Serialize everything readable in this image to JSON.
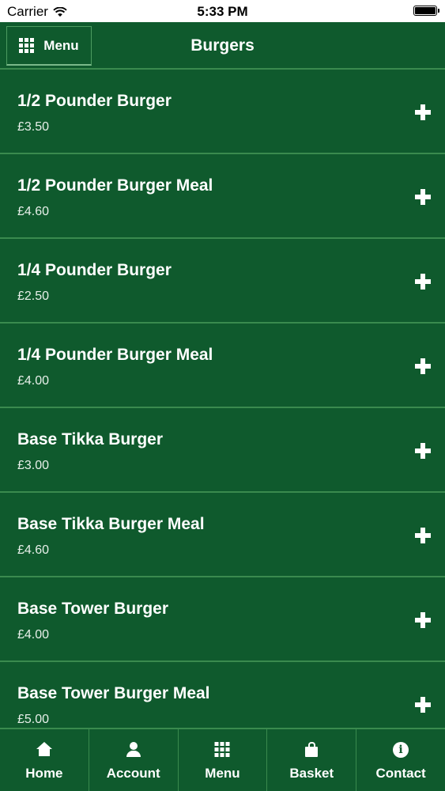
{
  "status_bar": {
    "carrier": "Carrier",
    "time": "5:33 PM"
  },
  "header": {
    "menu_label": "Menu",
    "title": "Burgers"
  },
  "items": [
    {
      "name": "1/2 Pounder Burger",
      "price": "£3.50"
    },
    {
      "name": "1/2 Pounder Burger Meal",
      "price": "£4.60"
    },
    {
      "name": "1/4 Pounder Burger",
      "price": "£2.50"
    },
    {
      "name": "1/4 Pounder Burger Meal",
      "price": "£4.00"
    },
    {
      "name": "Base Tikka Burger",
      "price": "£3.00"
    },
    {
      "name": "Base Tikka Burger Meal",
      "price": "£4.60"
    },
    {
      "name": "Base Tower Burger",
      "price": "£4.00"
    },
    {
      "name": "Base Tower Burger Meal",
      "price": "£5.00"
    }
  ],
  "tabs": [
    {
      "label": "Home",
      "icon": "home-icon"
    },
    {
      "label": "Account",
      "icon": "user-icon"
    },
    {
      "label": "Menu",
      "icon": "grid-icon"
    },
    {
      "label": "Basket",
      "icon": "bag-icon"
    },
    {
      "label": "Contact",
      "icon": "info-icon"
    }
  ],
  "colors": {
    "brand": "#0f5a2d",
    "divider": "#3a8a4e",
    "text": "#ffffff"
  }
}
